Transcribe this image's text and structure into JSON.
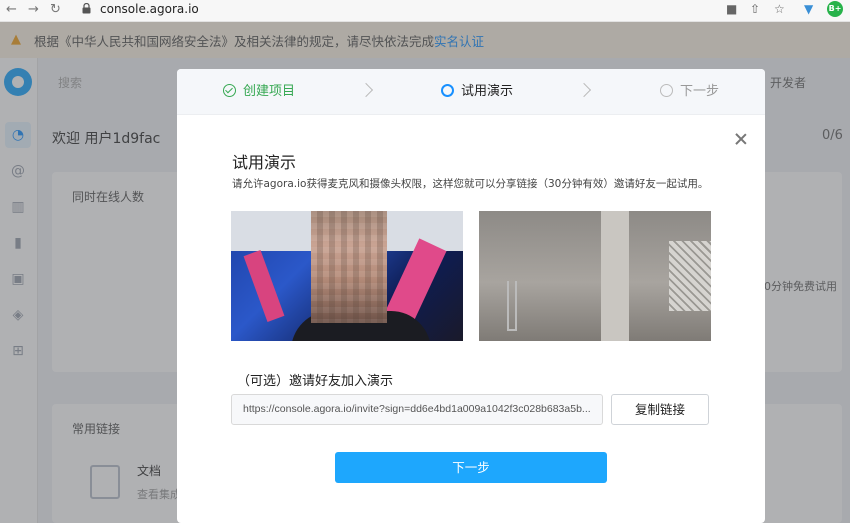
{
  "browser": {
    "url": "console.agora.io",
    "ext_badge": "B+"
  },
  "notice": {
    "text": "根据《中华人民共和国网络安全法》及相关法律的规定，请尽快依法完成",
    "link": "实名认证"
  },
  "background": {
    "search_placeholder": "搜索",
    "developer": "开发者",
    "welcome": "欢迎 用户1d9fac",
    "count": "0/6",
    "card_online": "同时在线人数",
    "side_text": "0分钟免费试用",
    "links_title": "常用链接",
    "doc_label": "文档",
    "doc_sub": "查看集成"
  },
  "modal": {
    "steps": [
      {
        "label": "创建项目",
        "state": "done"
      },
      {
        "label": "试用演示",
        "state": "active"
      },
      {
        "label": "下一步",
        "state": "todo"
      }
    ],
    "title": "试用演示",
    "description": "请允许agora.io获得麦克风和摄像头权限，这样您就可以分享链接（30分钟有效）邀请好友一起试用。",
    "invite_label": "（可选）邀请好友加入演示",
    "invite_url": "https://console.agora.io/invite?sign=dd6e4bd1a009a1042f3c028b683a5b...",
    "copy_button": "复制链接",
    "next_button": "下一步"
  },
  "colors": {
    "accent": "#1ea7fd",
    "done": "#36a852",
    "active": "#1890ff"
  }
}
